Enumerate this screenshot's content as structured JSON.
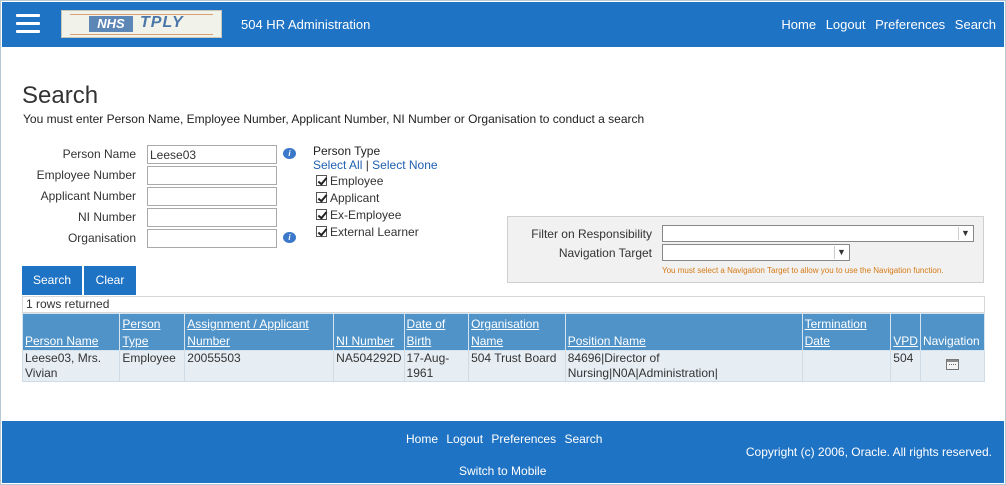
{
  "header": {
    "app_title": "504 HR Administration",
    "logo": {
      "nhs": "NHS",
      "tply": "TPLY"
    },
    "nav": [
      "Home",
      "Logout",
      "Preferences",
      "Search"
    ]
  },
  "page": {
    "title": "Search",
    "instruction": "You must enter Person Name, Employee Number, Applicant Number, NI Number or Organisation to conduct a search"
  },
  "form": {
    "person_name": {
      "label": "Person Name",
      "value": "Leese03"
    },
    "employee_number": {
      "label": "Employee Number",
      "value": ""
    },
    "applicant_number": {
      "label": "Applicant Number",
      "value": ""
    },
    "ni_number": {
      "label": "NI Number",
      "value": ""
    },
    "organisation": {
      "label": "Organisation",
      "value": ""
    }
  },
  "person_type": {
    "title": "Person Type",
    "select_all": "Select All",
    "separator": "|",
    "select_none": "Select None",
    "options": [
      {
        "label": "Employee",
        "checked": true
      },
      {
        "label": "Applicant",
        "checked": true
      },
      {
        "label": "Ex-Employee",
        "checked": true
      },
      {
        "label": "External Learner",
        "checked": true
      }
    ]
  },
  "filter": {
    "responsibility_label": "Filter on Responsibility",
    "responsibility_value": "",
    "navigation_label": "Navigation Target",
    "navigation_value": "",
    "hint": "You must select a Navigation Target to allow you to use the Navigation function."
  },
  "buttons": {
    "search": "Search",
    "clear": "Clear"
  },
  "results": {
    "rows_returned": "1 rows returned",
    "columns": [
      "Person Name",
      "Person Type",
      "Assignment / Applicant Number",
      "NI Number",
      "Date of Birth",
      "Organisation Name",
      "Position Name",
      "Termination Date",
      "VPD",
      "Navigation"
    ],
    "rows": [
      {
        "person_name": "Leese03, Mrs. Vivian",
        "person_type": "Employee",
        "assignment_number": "20055503",
        "ni_number": "NA504292D",
        "dob": "17-Aug-1961",
        "organisation": "504 Trust Board",
        "position": "84696|Director of Nursing|N0A|Administration|",
        "termination": "",
        "vpd": "504",
        "navigation_icon": "calendar-icon"
      }
    ]
  },
  "footer": {
    "nav": [
      "Home",
      "Logout",
      "Preferences",
      "Search"
    ],
    "mobile": "Switch to Mobile",
    "copyright": "Copyright (c) 2006, Oracle. All rights reserved."
  },
  "colors": {
    "brand_blue": "#1f73c4",
    "table_header": "#4f93c9",
    "row_bg": "#e6eef4",
    "hint_orange": "#d67a14"
  }
}
